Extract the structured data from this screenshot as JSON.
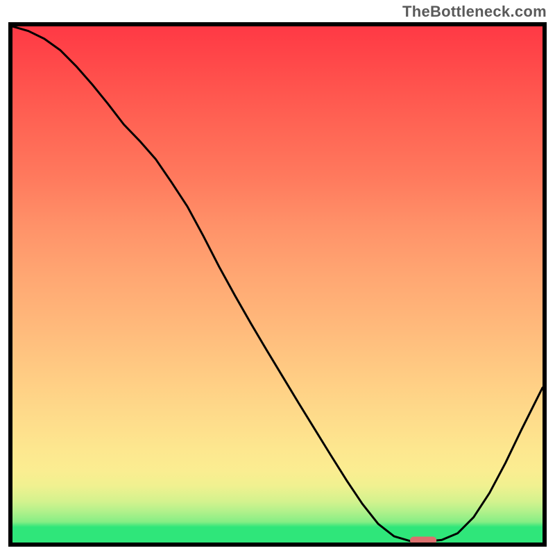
{
  "watermark": "TheBottleneck.com",
  "chart_data": {
    "type": "line",
    "title": "",
    "xlabel": "",
    "ylabel": "",
    "x": [
      0,
      3,
      6,
      9,
      12,
      15,
      18,
      21,
      24,
      27,
      30,
      33,
      36,
      39,
      42,
      45,
      48,
      51,
      54,
      57,
      60,
      63,
      66,
      69,
      72,
      75,
      78,
      81,
      84,
      87,
      90,
      93,
      96,
      100
    ],
    "values": [
      100,
      99.1,
      97.6,
      95.4,
      92.3,
      88.8,
      85.0,
      81.0,
      77.8,
      74.3,
      69.8,
      65.1,
      59.4,
      53.4,
      47.8,
      42.4,
      37.2,
      32.1,
      27.0,
      22.0,
      17.0,
      12.1,
      7.5,
      3.6,
      1.2,
      0.3,
      0.2,
      0.5,
      1.8,
      4.9,
      9.6,
      15.4,
      21.8,
      30.0
    ],
    "ylim": [
      0,
      100
    ],
    "xlim": [
      0,
      100
    ],
    "marker": {
      "x0": 75,
      "x1": 80,
      "y": 0.4
    },
    "gradient": "green-yellow-red (bottom to top)",
    "note": "Bottleneck-style chart: V-shaped curve over vertical heat gradient; optimal region marked near x≈75–80 at y≈0."
  }
}
